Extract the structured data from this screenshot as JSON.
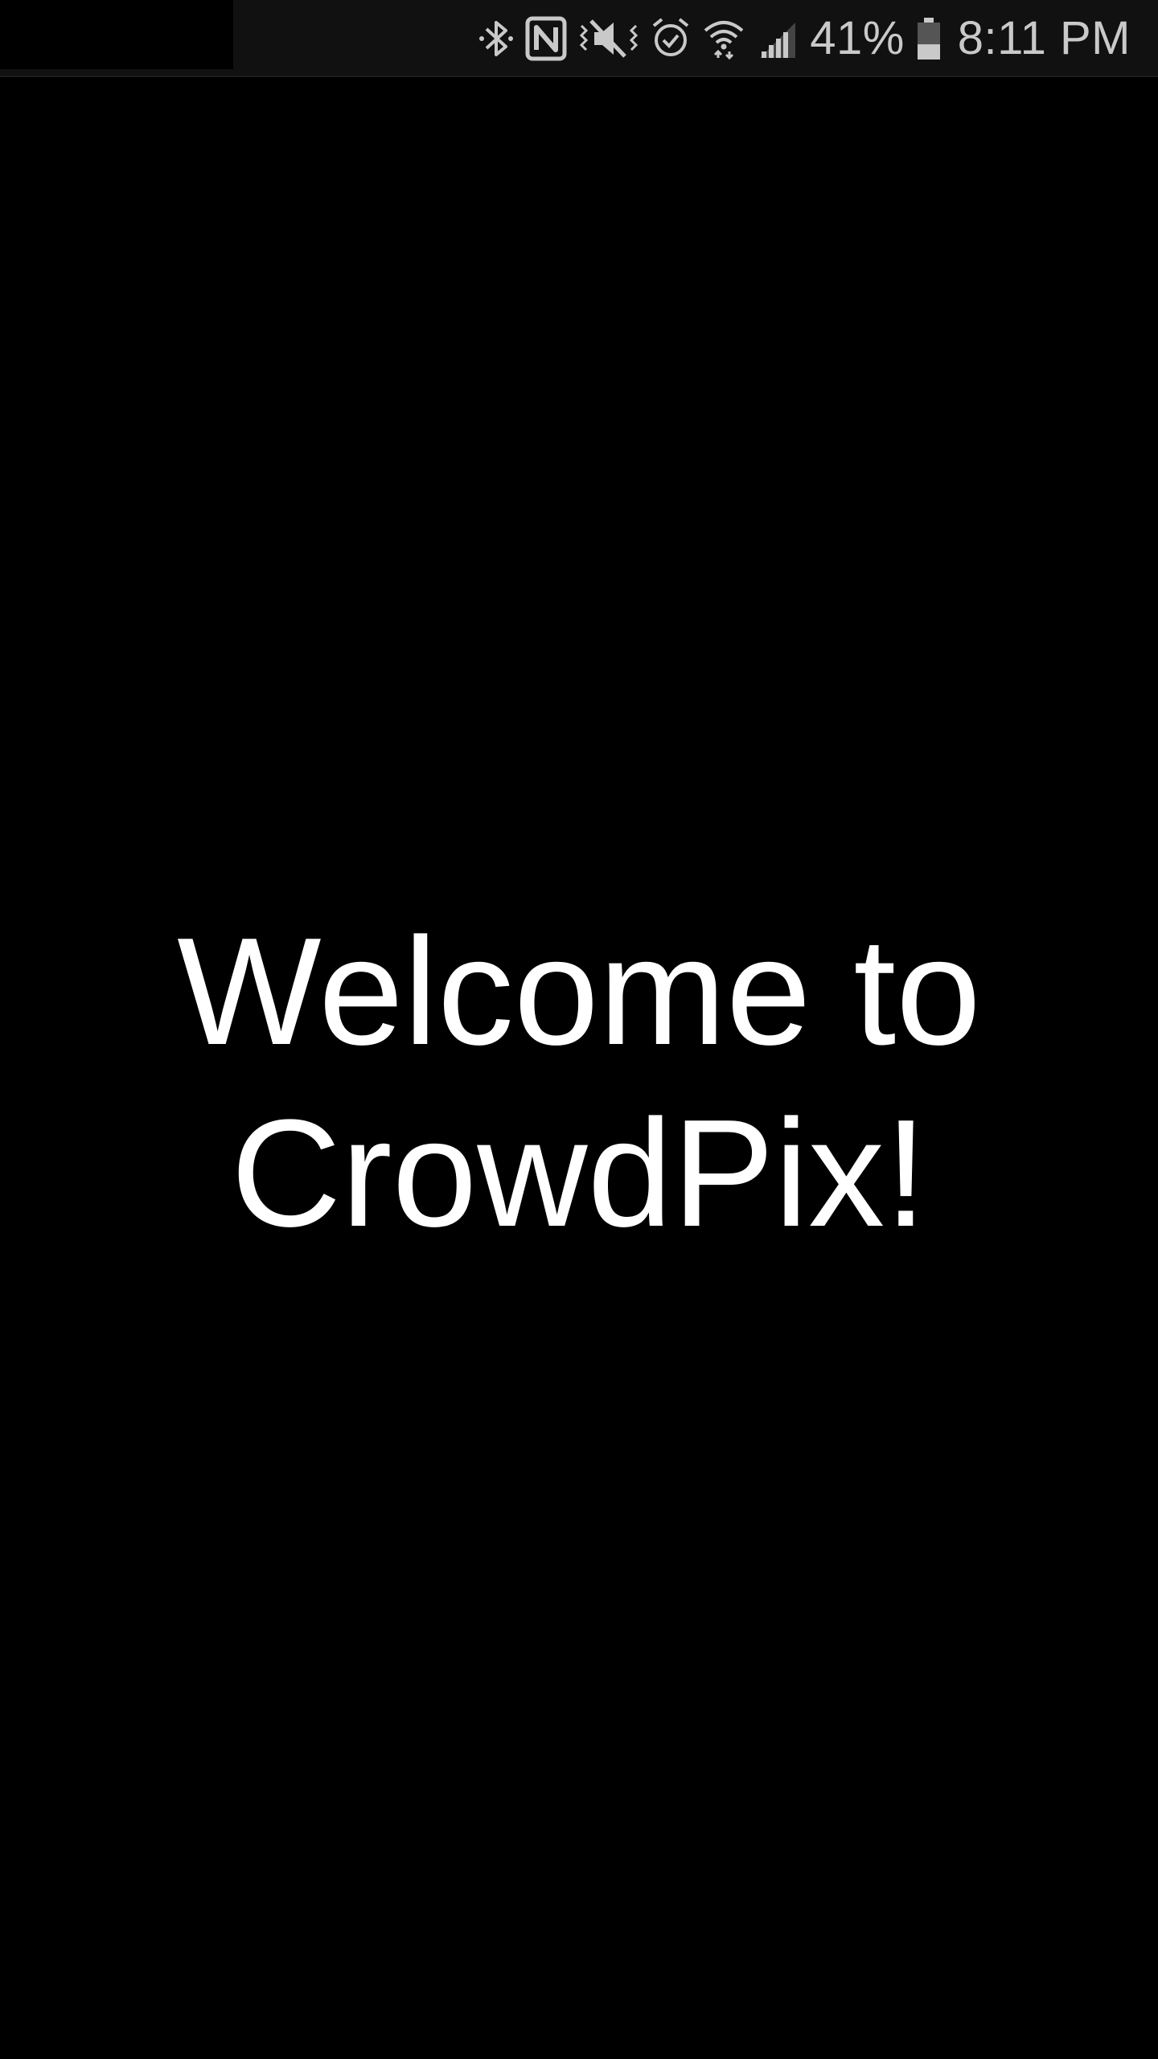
{
  "status_bar": {
    "icons": [
      "bluetooth-icon",
      "nfc-icon",
      "vibrate-mute-icon",
      "alarm-icon",
      "wifi-icon",
      "signal-icon"
    ],
    "battery_percent_text": "41%",
    "battery_level": 0.41,
    "time": "8:11 PM",
    "icon_color": "#c9c9c9"
  },
  "welcome": {
    "line1": "Welcome to",
    "line2": "CrowdPix!",
    "text_color": "#ffffff",
    "background_color": "#000000"
  }
}
